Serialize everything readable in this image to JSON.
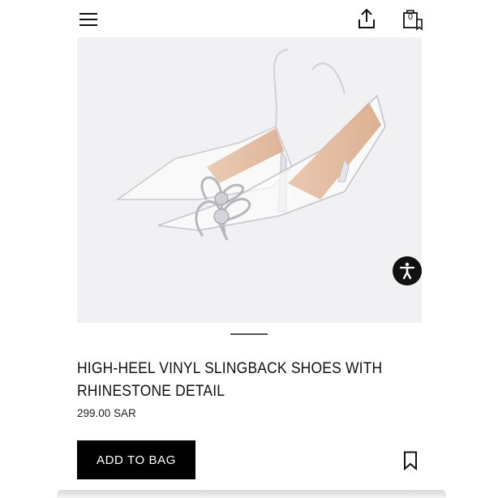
{
  "header": {
    "menu_icon": "hamburger-menu-icon",
    "share_icon": "share-upload-icon",
    "bag_icon": "shopping-bag-icon",
    "bag_count": "0"
  },
  "product": {
    "image_alt": "clear vinyl pointed slingback heels with rhinestone bow",
    "title": "HIGH-HEEL VINYL SLINGBACK SHOES WITH RHINESTONE DETAIL",
    "price": "299.00 SAR",
    "add_to_bag_label": "ADD TO BAG",
    "save_icon": "bookmark-icon"
  },
  "accessibility": {
    "icon": "accessibility-person-icon"
  },
  "colors": {
    "accent": "#000000",
    "background": "#ffffff",
    "image_bg": "#f1f1f3"
  }
}
